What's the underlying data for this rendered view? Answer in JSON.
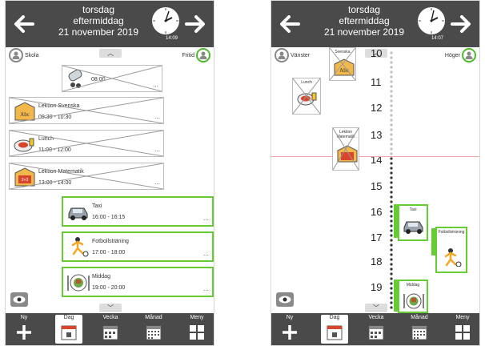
{
  "screen_a": {
    "header": {
      "weekday": "torsdag",
      "period": "eftermiddag",
      "date": "21 november 2019",
      "clock_time": "14:09"
    },
    "sub": {
      "left_label": "Skola",
      "right_label": "Fritid"
    },
    "events": [
      {
        "title": "",
        "time": "08:00",
        "done": true,
        "picto": "pills-icon"
      },
      {
        "title": "Lektion Svenska",
        "time": "09:30 - 10:30",
        "done": true,
        "picto": "abc-book-icon"
      },
      {
        "title": "Lunch",
        "time": "11:00 - 12:00",
        "done": true,
        "picto": "lunch-plate-icon"
      },
      {
        "title": "Lektion Matematik",
        "time": "13:00 - 14:00",
        "done": true,
        "picto": "math-book-icon"
      },
      {
        "title": "Taxi",
        "time": "16:00 - 16:15",
        "done": false,
        "picto": "car-icon"
      },
      {
        "title": "Fotbollsträning",
        "time": "17:00 - 18:00",
        "done": false,
        "picto": "football-player-icon"
      },
      {
        "title": "Middag",
        "time": "19:00 - 20:00",
        "done": false,
        "picto": "dinner-plate-icon"
      }
    ]
  },
  "screen_b": {
    "header": {
      "weekday": "torsdag",
      "period": "eftermiddag",
      "date": "21 november 2019",
      "clock_time": "14:07"
    },
    "sub": {
      "left_label": "Vänster",
      "right_label": "Höger"
    },
    "hours": [
      "10",
      "11",
      "12",
      "13",
      "14",
      "15",
      "16",
      "17",
      "18",
      "19"
    ],
    "mini_events": [
      {
        "label": "Svenska",
        "side": "left"
      },
      {
        "label": "Lunch",
        "side": "left"
      },
      {
        "label": "Lektion Matematik",
        "side": "left"
      },
      {
        "label": "Taxi",
        "side": "right"
      },
      {
        "label": "Fotbollsträning",
        "side": "right"
      },
      {
        "label": "Middag",
        "side": "right"
      }
    ]
  },
  "toolbar": {
    "new": "Ny",
    "day": "Dag",
    "week": "Vecka",
    "month": "Månad",
    "menu": "Meny"
  },
  "colors": {
    "header_bg": "#4a4a4a",
    "active_border": "#66cc33",
    "now_line": "#f2a6a6"
  }
}
